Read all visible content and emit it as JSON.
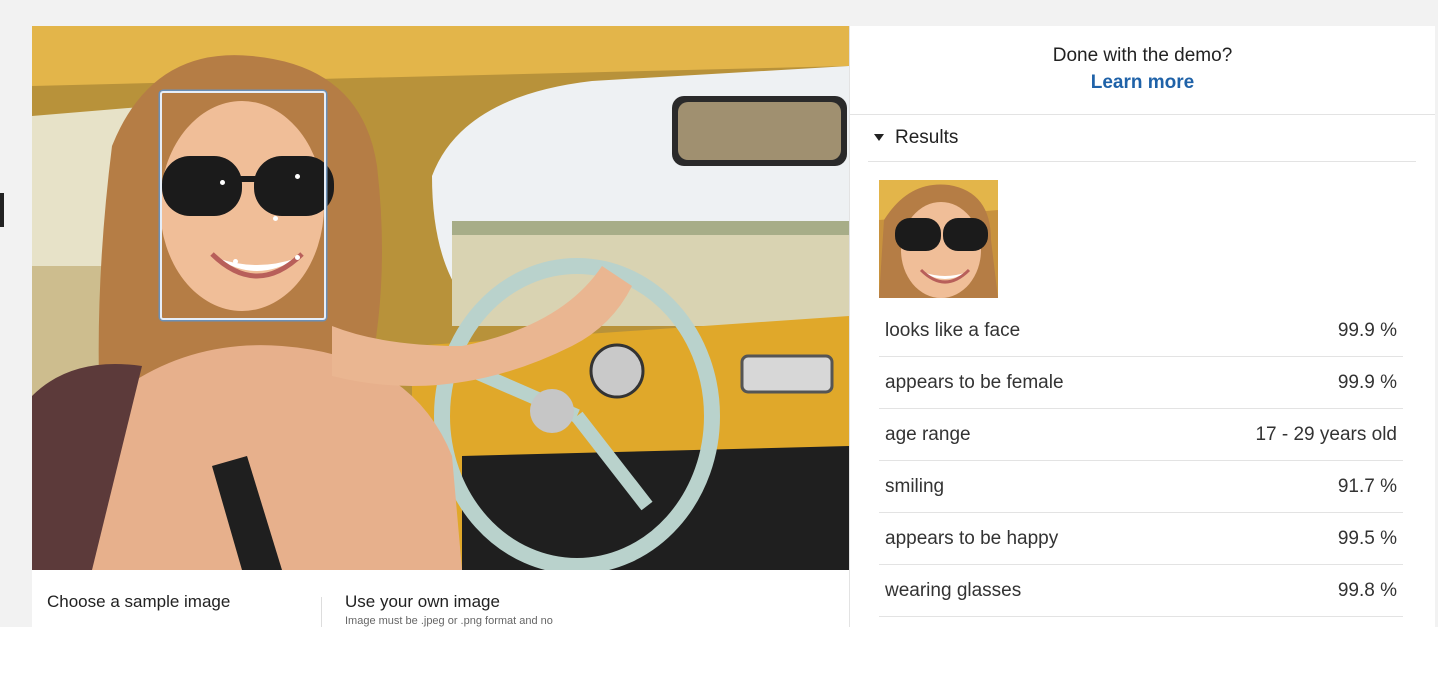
{
  "demo_panel": {
    "done_text": "Done with the demo?",
    "learn_more": "Learn more"
  },
  "results": {
    "title": "Results",
    "attributes": [
      {
        "label": "looks like a face",
        "value": "99.9 %"
      },
      {
        "label": "appears to be female",
        "value": "99.9 %"
      },
      {
        "label": "age range",
        "value": "17 - 29 years old"
      },
      {
        "label": "smiling",
        "value": "91.7 %"
      },
      {
        "label": "appears to be happy",
        "value": "99.5 %"
      },
      {
        "label": "wearing glasses",
        "value": "99.8 %"
      }
    ]
  },
  "image_picker": {
    "sample_label": "Choose a sample image",
    "own_label": "Use your own image",
    "own_hint": "Image must be .jpeg or .png format and no"
  },
  "colors": {
    "link": "#1f62a8",
    "face_box": "#e6eef8",
    "page_background": "#f2f2f2"
  }
}
